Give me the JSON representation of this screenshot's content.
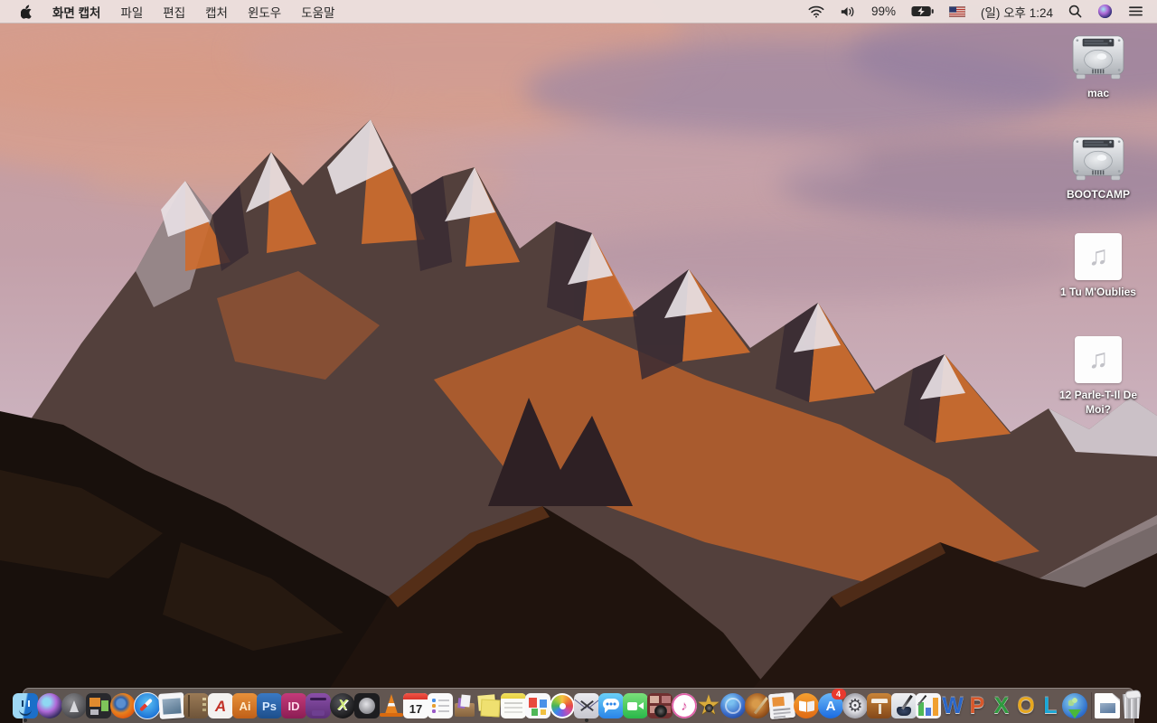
{
  "menu_bar": {
    "app_name": "화면 캡처",
    "menus": [
      "파일",
      "편집",
      "캡처",
      "윈도우",
      "도움말"
    ],
    "status": {
      "battery_percent": "99%",
      "clock": "(일) 오후 1:24",
      "icons": [
        "wifi-icon",
        "volume-icon",
        "battery-charging-icon",
        "us-flag-icon",
        "spotlight-search-icon",
        "siri-icon",
        "notification-center-icon"
      ]
    }
  },
  "desktop": {
    "icons": [
      {
        "name": "mac",
        "label": "mac",
        "type": "hard-drive"
      },
      {
        "name": "bootcamp",
        "label": "BOOTCAMP",
        "type": "hard-drive"
      },
      {
        "name": "tu-moublies",
        "label": "1 Tu M'Oublies",
        "type": "audio-file",
        "glyph": "♫"
      },
      {
        "name": "parle-t-il-de-moi",
        "label": "12 Parle-T-Il De Moi?",
        "type": "audio-file",
        "glyph": "♫"
      }
    ]
  },
  "dock": {
    "items": [
      {
        "name": "finder",
        "type": "finder",
        "running": true
      },
      {
        "name": "siri",
        "type": "siri"
      },
      {
        "name": "launchpad",
        "type": "launchpad"
      },
      {
        "name": "mission-control",
        "type": "mission-control"
      },
      {
        "name": "firefox",
        "type": "firefox"
      },
      {
        "name": "safari",
        "type": "safari"
      },
      {
        "name": "preview",
        "type": "preview"
      },
      {
        "name": "contacts",
        "type": "contacts"
      },
      {
        "name": "acrobat",
        "type": "acrobat",
        "glyph": "A"
      },
      {
        "name": "illustrator",
        "type": "illustrator",
        "glyph": "Ai"
      },
      {
        "name": "photoshop",
        "type": "photoshop",
        "glyph": "Ps"
      },
      {
        "name": "indesign",
        "type": "indesign",
        "glyph": "ID"
      },
      {
        "name": "toast",
        "type": "toast"
      },
      {
        "name": "xbench",
        "type": "xsphere",
        "glyph": "X"
      },
      {
        "name": "disk-tool",
        "type": "diskapp"
      },
      {
        "name": "vlc",
        "type": "vlc"
      },
      {
        "name": "calendar",
        "type": "calendar",
        "glyph": "17"
      },
      {
        "name": "reminders",
        "type": "reminders"
      },
      {
        "name": "unarchiver",
        "type": "unarchiver"
      },
      {
        "name": "stickies",
        "type": "stickies"
      },
      {
        "name": "notes",
        "type": "notes"
      },
      {
        "name": "documents",
        "type": "docsapp"
      },
      {
        "name": "photos",
        "type": "photos"
      },
      {
        "name": "screen-capture",
        "type": "grab",
        "running": true
      },
      {
        "name": "messages",
        "type": "messages"
      },
      {
        "name": "facetime",
        "type": "facetime"
      },
      {
        "name": "photo-booth",
        "type": "photobooth"
      },
      {
        "name": "itunes",
        "type": "itunes",
        "glyph": "♪"
      },
      {
        "name": "imovie",
        "type": "imovie",
        "glyph": "★"
      },
      {
        "name": "idvd",
        "type": "idvd"
      },
      {
        "name": "garageband",
        "type": "garageband"
      },
      {
        "name": "iweb",
        "type": "iweb"
      },
      {
        "name": "ibooks",
        "type": "ibooks"
      },
      {
        "name": "app-store",
        "type": "appstore",
        "glyph": "A",
        "badge": "4"
      },
      {
        "name": "system-preferences",
        "type": "sysprefs",
        "glyph": "⚙"
      },
      {
        "name": "keynote",
        "type": "keynote"
      },
      {
        "name": "pages",
        "type": "pages"
      },
      {
        "name": "numbers",
        "type": "numbers"
      },
      {
        "name": "word",
        "type": "word",
        "glyph": "W"
      },
      {
        "name": "powerpoint",
        "type": "powerpoint",
        "glyph": "P"
      },
      {
        "name": "excel",
        "type": "excel",
        "glyph": "X"
      },
      {
        "name": "outlook",
        "type": "outlook",
        "glyph": "O"
      },
      {
        "name": "lync",
        "type": "lync",
        "glyph": "L"
      },
      {
        "name": "downloader",
        "type": "downloader"
      },
      {
        "name": "divider",
        "type": "divider"
      },
      {
        "name": "document-file",
        "type": "docfile"
      },
      {
        "name": "trash",
        "type": "trash"
      }
    ]
  }
}
